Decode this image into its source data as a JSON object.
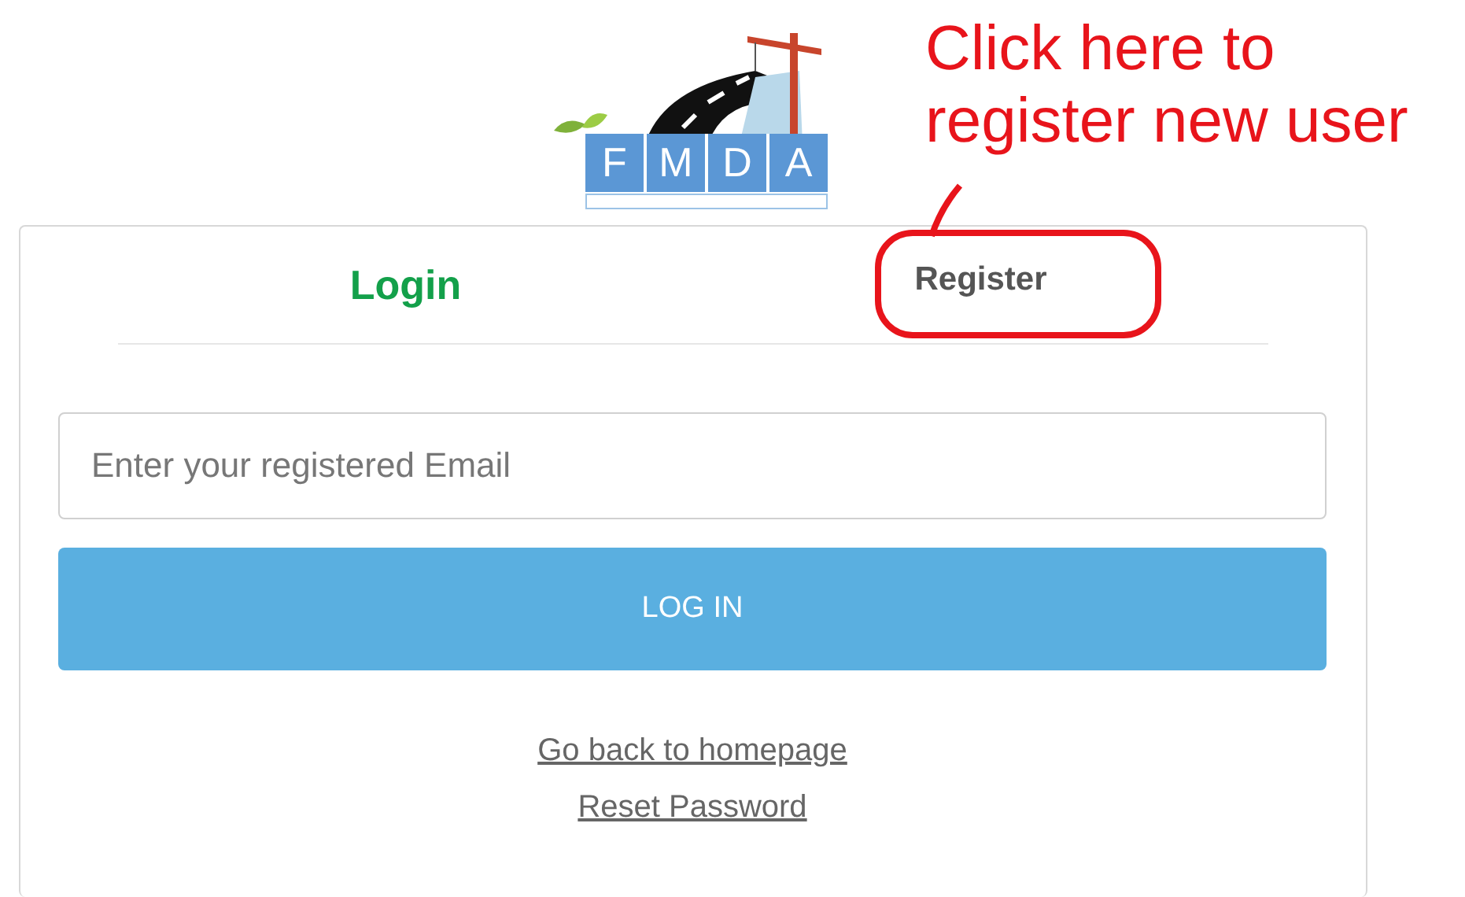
{
  "logo": {
    "letters": [
      "F",
      "M",
      "D",
      "A"
    ]
  },
  "annotation": {
    "text": "Click here to register new user"
  },
  "tabs": [
    {
      "label": "Login",
      "selected": true
    },
    {
      "label": "Register",
      "selected": false
    }
  ],
  "email_field": {
    "placeholder": "Enter your registered Email"
  },
  "login_button": {
    "label": "LOG IN"
  },
  "links": [
    "Go back to homepage",
    "Reset Password"
  ]
}
